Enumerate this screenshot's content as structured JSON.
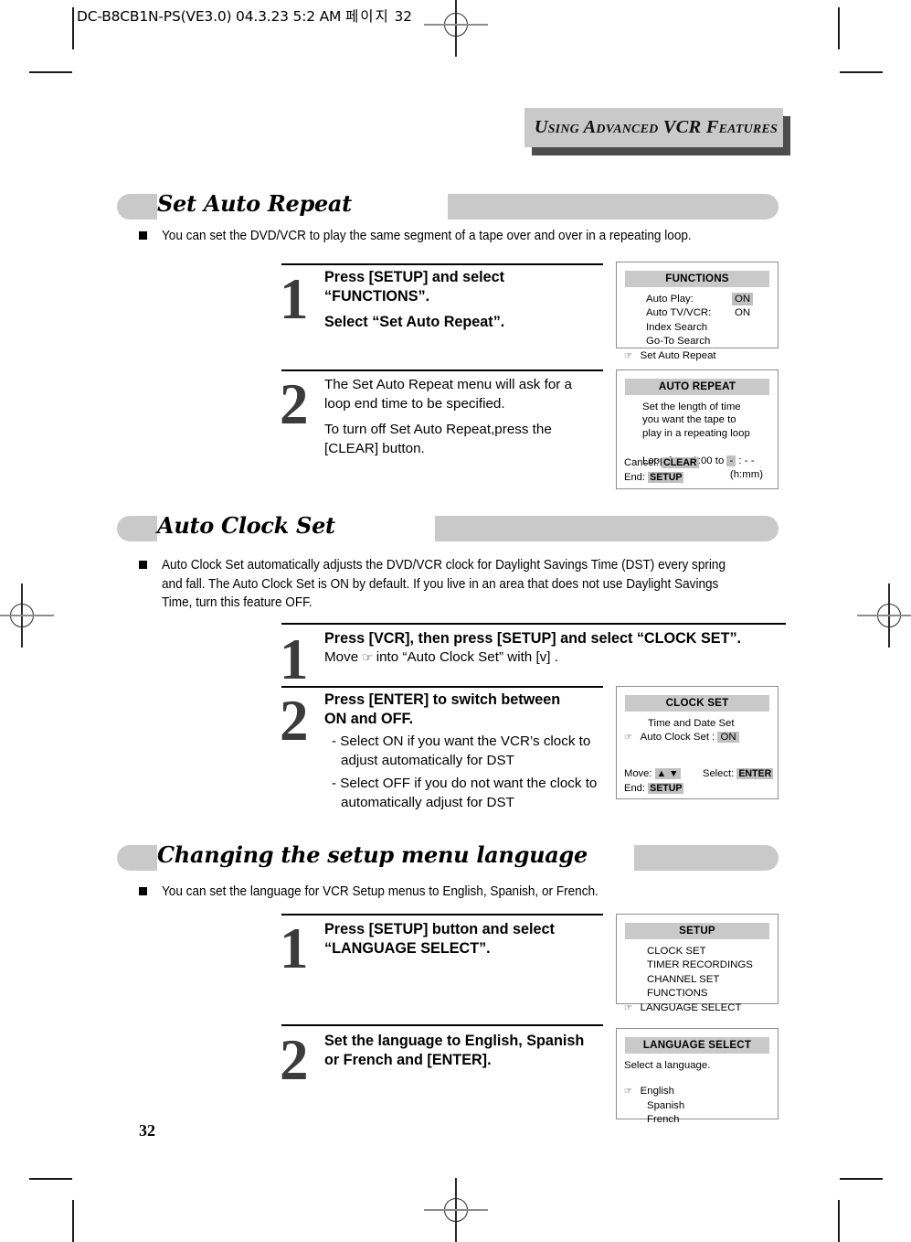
{
  "print_slug": {
    "text": "DC-B8CB1N-PS(VE3.0)  04.3.23 5:2 AM",
    "cjk": "페이지",
    "page": "32"
  },
  "running_head": {
    "title": "Using Advanced VCR Features"
  },
  "page_number": "32",
  "sections": [
    {
      "title": "Set Auto Repeat",
      "intro": "You can set the DVD/VCR to play the same segment of a tape over and over in a repeating loop.",
      "steps": [
        {
          "number": "1",
          "bold_lines": [
            "Press [SETUP] and select",
            "“FUNCTIONS”."
          ],
          "bold_lines2": [
            "Select “Set Auto Repeat”."
          ],
          "plain_lines": []
        },
        {
          "number": "2",
          "plain_lines": [
            "The Set Auto Repeat menu will ask for a",
            "loop end time to be specified."
          ],
          "plain_lines2": [
            "To turn off Set Auto Repeat,press the",
            "[CLEAR] button."
          ]
        }
      ]
    },
    {
      "title": "Auto Clock Set",
      "intro": "Auto Clock Set automatically adjusts the DVD/VCR clock for Daylight Savings Time (DST) every spring and fall. The Auto Clock Set is ON by default. If you live in an area that does not use Daylight Savings Time, turn this feature OFF.",
      "steps": [
        {
          "number": "1",
          "bold_lines": [
            "Press [VCR], then press [SETUP] and select “CLOCK SET”."
          ],
          "plain_prefix": "Move ",
          "pointer": "☞",
          "plain_suffix": " into “Auto Clock Set” with [v] ."
        },
        {
          "number": "2",
          "bold_lines": [
            "Press [ENTER] to switch between",
            "ON and OFF."
          ],
          "sub_lines": [
            "- Select ON if you want the VCR’s clock to adjust automatically for DST",
            "- Select OFF if you do not want the clock to automatically adjust for DST"
          ]
        }
      ]
    },
    {
      "title": "Changing the setup menu language",
      "intro": "You can set the language for VCR Setup menus to English, Spanish, or French.",
      "steps": [
        {
          "number": "1",
          "bold_lines": [
            "Press [SETUP] button and select",
            "“LANGUAGE SELECT”."
          ]
        },
        {
          "number": "2",
          "bold_lines": [
            "Set the language to English, Spanish",
            "or French and [ENTER]."
          ]
        }
      ]
    }
  ],
  "osd_screens": {
    "functions": {
      "title": "FUNCTIONS",
      "rows": [
        {
          "pointer": "",
          "label": "Auto Play:",
          "value": "ON",
          "highlight": true
        },
        {
          "pointer": "",
          "label": "Auto TV/VCR:",
          "value": "ON",
          "highlight": false
        },
        {
          "pointer": "",
          "label": "Index Search",
          "value": "",
          "highlight": false
        },
        {
          "pointer": "",
          "label": "Go-To Search",
          "value": "",
          "highlight": false
        },
        {
          "pointer": "☞",
          "label": "Set Auto Repeat",
          "value": "",
          "highlight": false
        }
      ]
    },
    "auto_repeat": {
      "title": "AUTO REPEAT",
      "description": [
        "Set the length of time",
        "you want the tape to",
        "play in a repeating loop"
      ],
      "loop_prefix": "Loop from 0:00 to ",
      "loop_cursor": "-",
      "loop_suffix": " : - -",
      "loop_units": "(h:mm)",
      "cancel_label": "Cancel:",
      "cancel_key": "CLEAR",
      "end_label": "End:",
      "end_key": "SETUP"
    },
    "clock_set": {
      "title": "CLOCK SET",
      "rows": [
        {
          "pointer": "",
          "label": "Time and Date Set",
          "value": "",
          "highlight": false
        },
        {
          "pointer": "☞",
          "label": "Auto Clock Set :",
          "value": "ON",
          "highlight": true
        }
      ],
      "move_label": "Move:",
      "move_icons": "▲ ▼",
      "select_label": "Select:",
      "select_key": "ENTER",
      "end_label": "End:",
      "end_key": "SETUP"
    },
    "setup": {
      "title": "SETUP",
      "rows": [
        {
          "pointer": "",
          "label": "CLOCK SET"
        },
        {
          "pointer": "",
          "label": "TIMER RECORDINGS"
        },
        {
          "pointer": "",
          "label": "CHANNEL SET"
        },
        {
          "pointer": "",
          "label": "FUNCTIONS"
        },
        {
          "pointer": "☞",
          "label": "LANGUAGE SELECT"
        }
      ]
    },
    "language_select": {
      "title": "LANGUAGE SELECT",
      "prompt": "Select a language.",
      "rows": [
        {
          "pointer": "☞",
          "label": "English"
        },
        {
          "pointer": "",
          "label": "Spanish"
        },
        {
          "pointer": "",
          "label": "French"
        }
      ]
    }
  }
}
